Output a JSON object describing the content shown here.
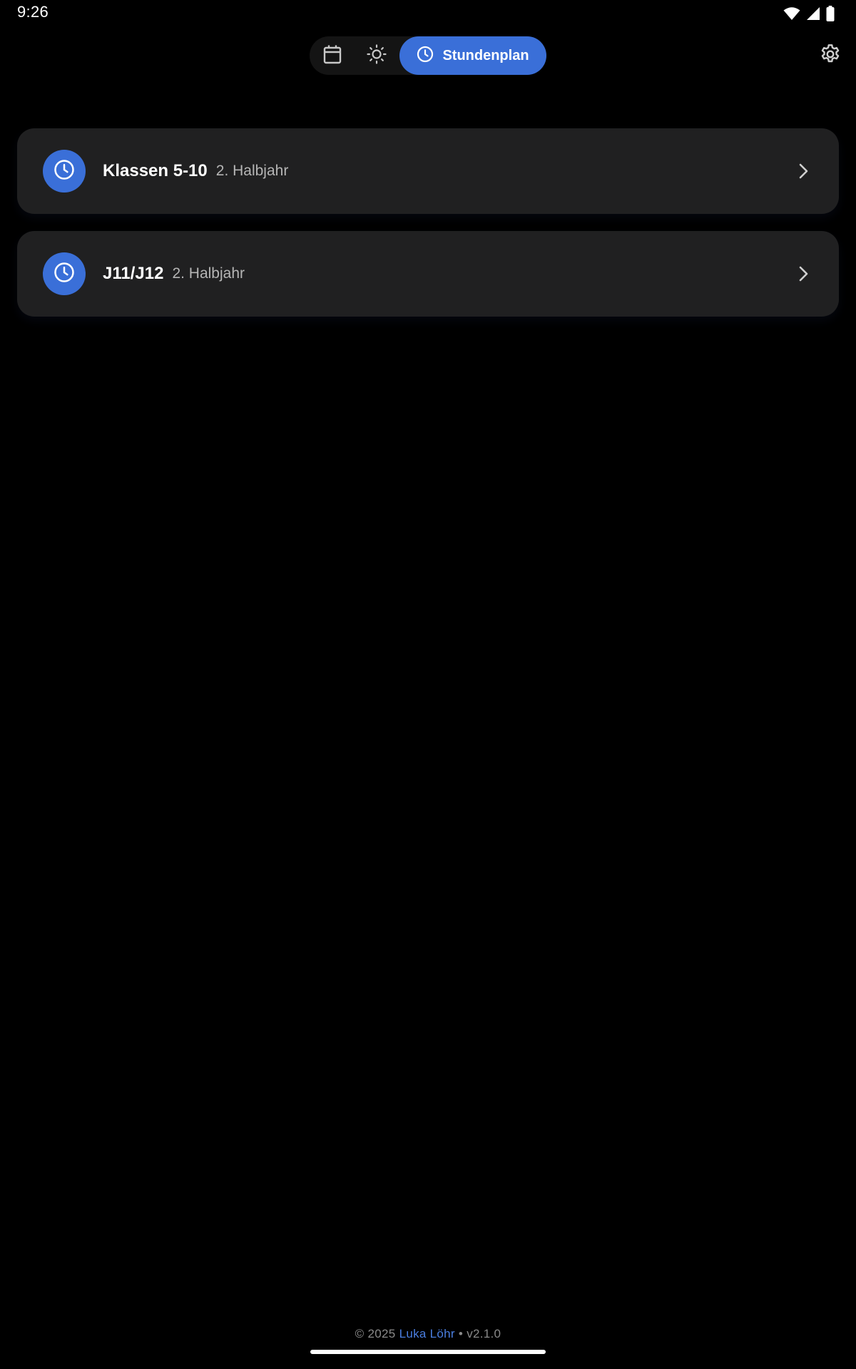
{
  "status_bar": {
    "time": "9:26",
    "icons": [
      "wifi-icon",
      "cell-signal-icon",
      "battery-icon"
    ]
  },
  "top_nav": {
    "segments": [
      {
        "icon": "calendar-icon",
        "label": "",
        "selected": false
      },
      {
        "icon": "sun-icon",
        "label": "",
        "selected": false
      },
      {
        "icon": "clock-icon",
        "label": "Stundenplan",
        "selected": true
      }
    ],
    "settings_icon": "gear-icon"
  },
  "cards": [
    {
      "icon": "clock-icon",
      "title": "Klassen 5-10",
      "subtitle": "2. Halbjahr",
      "trailing_icon": "chevron-right-icon"
    },
    {
      "icon": "clock-icon",
      "title": "J11/J12",
      "subtitle": "2. Halbjahr",
      "trailing_icon": "chevron-right-icon"
    }
  ],
  "footer": {
    "copyright": "© 2025",
    "author": "Luka Löhr",
    "separator": "•",
    "version": "v2.1.0"
  },
  "colors": {
    "background": "#000000",
    "accent": "#3a6fd8",
    "card": "#202021",
    "segmented_bg": "#141414",
    "footer_text": "#8a8a8a",
    "link": "#4a7ee0"
  }
}
